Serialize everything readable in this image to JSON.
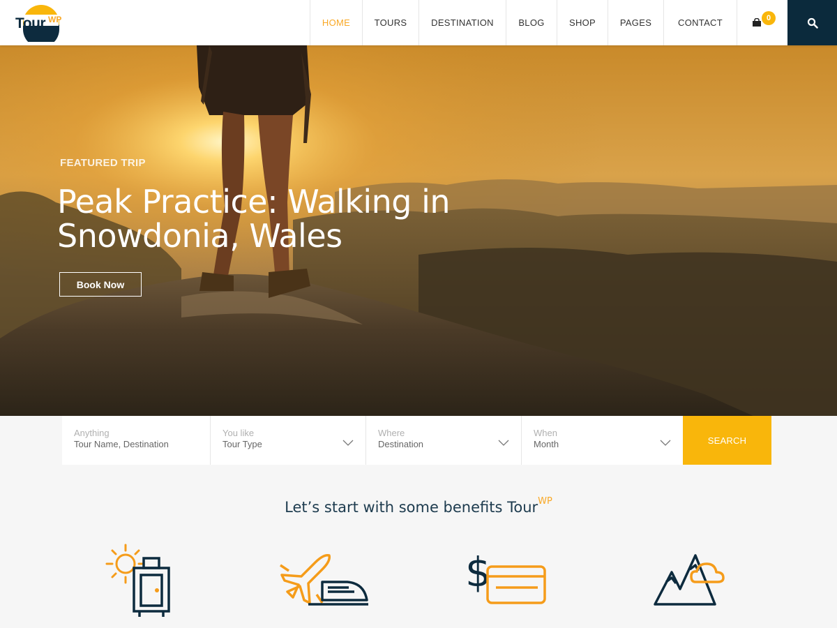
{
  "brand": {
    "name": "Tour",
    "sup": "WP"
  },
  "nav": [
    {
      "label": "HOME",
      "active": true
    },
    {
      "label": "TOURS",
      "active": false
    },
    {
      "label": "DESTINATION",
      "active": false
    },
    {
      "label": "BLOG",
      "active": false
    },
    {
      "label": "SHOP",
      "active": false
    },
    {
      "label": "PAGES",
      "active": false
    },
    {
      "label": "CONTACT",
      "active": false
    }
  ],
  "cart": {
    "count": "0",
    "icon": "cart-icon"
  },
  "search_icon": "search-icon",
  "hero": {
    "eyebrow": "FEATURED TRIP",
    "title": "Peak Practice: Walking in Snowdonia, Wales",
    "button": "Book Now"
  },
  "search": {
    "fields": [
      {
        "label": "Anything",
        "value": "Tour Name, Destination",
        "dropdown": false
      },
      {
        "label": "You like",
        "value": "Tour Type",
        "dropdown": true
      },
      {
        "label": "Where",
        "value": "Destination",
        "dropdown": true
      },
      {
        "label": "When",
        "value": "Month",
        "dropdown": true
      }
    ],
    "submit": "SEARCH"
  },
  "benefits": {
    "title": "Let’s start with some benefits Tour",
    "title_sup": "WP",
    "icons": [
      "sun-luggage-icon",
      "plane-train-icon",
      "dollar-card-icon",
      "mountain-cloud-icon"
    ]
  },
  "colors": {
    "accent": "#f9b60b",
    "navy": "#0b2a3c"
  }
}
